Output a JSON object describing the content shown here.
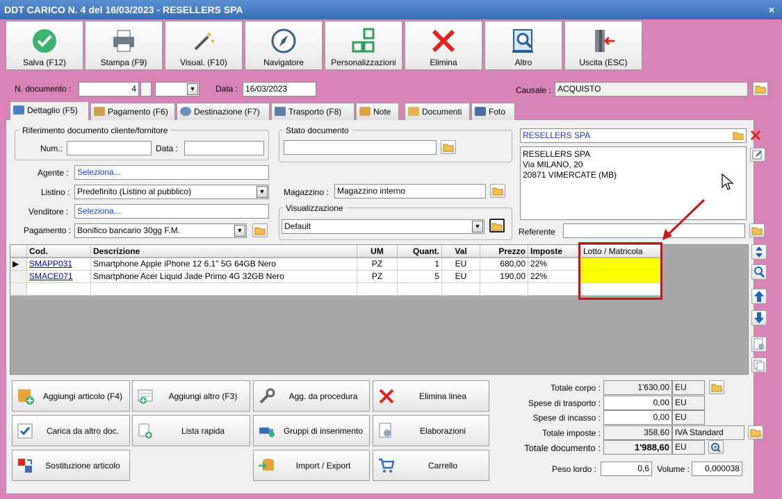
{
  "window": {
    "title": "DDT CARICO N. 4 del 16/03/2023 - RESELLERS SPA",
    "close": "×"
  },
  "toolbar": [
    {
      "label": "Salva (F12)"
    },
    {
      "label": "Stampa (F9)"
    },
    {
      "label": "Visual. (F10)"
    },
    {
      "label": "Navigatore"
    },
    {
      "label": "Personalizzazioni"
    },
    {
      "label": "Elimina"
    },
    {
      "label": "Altro"
    },
    {
      "label": "Uscita (ESC)"
    }
  ],
  "header": {
    "doc_label": "N. documento :",
    "doc_number": "4",
    "doc_suffix": "",
    "date_label": "Data :",
    "date": "16/03/2023",
    "causale_label": "Causale :",
    "causale": "ACQUISTO"
  },
  "tabs": [
    {
      "label": "Dettaglio (F5)"
    },
    {
      "label": "Pagamento (F6)"
    },
    {
      "label": "Destinazione (F7)"
    },
    {
      "label": "Trasporto (F8)"
    },
    {
      "label": "Note"
    },
    {
      "label": "Documenti"
    },
    {
      "label": "Foto"
    }
  ],
  "rif": {
    "title": "Riferimento documento cliente/fornitore",
    "num_label": "Num.:",
    "num": "",
    "data_label": "Data :",
    "data": ""
  },
  "fields": {
    "agente_label": "Agente :",
    "agente": "Seleziona...",
    "listino_label": "Listino :",
    "listino": "Predefinito (Listino al pubblico)",
    "venditore_label": "Venditore :",
    "venditore": "Seleziona...",
    "pagamento_label": "Pagamento :",
    "pagamento": "Bonifico bancario 30gg F.M."
  },
  "stato": {
    "title": "Stato documento",
    "value": ""
  },
  "magazzino": {
    "label": "Magazzino :",
    "value": "Magazzino interno"
  },
  "visual": {
    "title": "Visualizzazione",
    "value": "Default"
  },
  "customer": {
    "name": "RESELLERS SPA",
    "address_lines": [
      "RESELLERS SPA",
      "Via MILANO, 20",
      "20871 VIMERCATE (MB)"
    ],
    "referente_label": "Referente",
    "referente": ""
  },
  "grid": {
    "columns": [
      "Cod.",
      "Descrizione",
      "UM",
      "Quant.",
      "Val",
      "Prezzo",
      "Imposte",
      "Lotto / Matricola"
    ],
    "rows": [
      {
        "cod": "SMAPP031",
        "desc": "Smartphone Apple iPhone 12 6,1\" 5G 64GB Nero",
        "um": "PZ",
        "quant": "1",
        "val": "EU",
        "prezzo": "680,00",
        "imposte": "22%",
        "lotto": ""
      },
      {
        "cod": "SMACE071",
        "desc": "Smartphone Acer Liquid Jade Primo 4G 32GB Nero",
        "um": "PZ",
        "quant": "5",
        "val": "EU",
        "prezzo": "190,00",
        "imposte": "22%",
        "lotto": ""
      }
    ]
  },
  "actions": [
    {
      "label": "Aggiungi articolo (F4)"
    },
    {
      "label": "Aggiungi altro (F3)"
    },
    {
      "label": "Agg. da procedura"
    },
    {
      "label": "Elimina linea"
    },
    {
      "label": "Carica da altro doc."
    },
    {
      "label": "Lista rapida"
    },
    {
      "label": "Gruppi di inserimento"
    },
    {
      "label": "Elaborazioni"
    },
    {
      "label": "Sostituzione articolo"
    },
    {
      "label": "Import / Export"
    },
    {
      "label": "Carrello"
    }
  ],
  "totals": {
    "corpo_label": "Totale corpo :",
    "corpo": "1'630,00",
    "corpo_cur": "EU",
    "trasporto_label": "Spese di trasporto :",
    "trasporto": "0,00",
    "trasporto_cur": "EU",
    "incasso_label": "Spese di incasso :",
    "incasso": "0,00",
    "incasso_cur": "EU",
    "imposte_label": "Totale imposte :",
    "imposte": "358,60",
    "imposte_desc": "IVA Standard",
    "documento_label": "Totale documento :",
    "documento": "1'988,60",
    "documento_cur": "EU",
    "peso_label": "Peso lordo :",
    "peso": "0,6",
    "volume_label": "Volume :",
    "volume": "0,000038"
  },
  "colors": {
    "background": "#d984b6",
    "titlebar": "#3a6db5",
    "highlight_red": "#c8151b",
    "lotto_yellow": "#ffff00"
  }
}
